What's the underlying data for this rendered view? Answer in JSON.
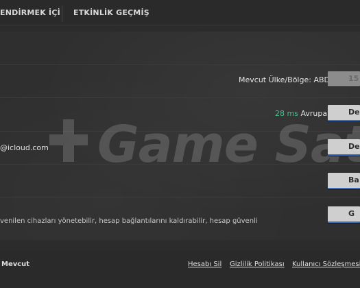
{
  "tabs": [
    {
      "label": "ENDİRMEK İÇİN TA"
    },
    {
      "label": "ETKİNLİK GEÇMİŞİ"
    }
  ],
  "settings": {
    "region_label": "Mevcut Ülke/Bölge: ABD",
    "region_button": "15",
    "latency_value": "28 ms",
    "server_region": "Avrupa",
    "server_button": "Değ",
    "email_fragment": "@icloud.com",
    "email_button": "Değ",
    "row4_button": "Ba",
    "devices_text": "venilen cihazları yönetebilir, hesap bağlantılarını kaldırabilir, hesap güvenli",
    "devices_button": "G"
  },
  "watermark": "Game Satış",
  "footer": {
    "brand": "Mevcut",
    "delete_account": "Hesabı Sil",
    "privacy_policy": "Gizlilik Politikası",
    "user_agreement": "Kullanıcı Sözleşmesi"
  },
  "colors": {
    "background": "#2c2c2c",
    "latency_green": "#43c28d",
    "button_bg": "#cfcfcf",
    "button_accent": "#3d6cb6"
  }
}
